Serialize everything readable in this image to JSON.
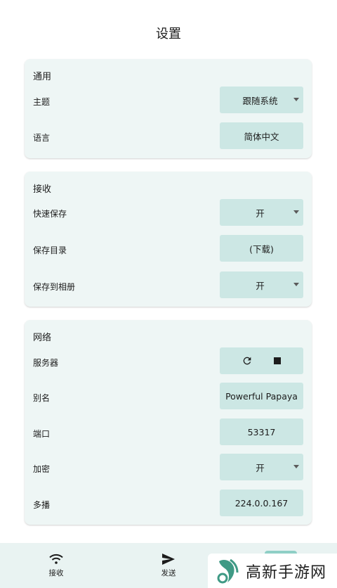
{
  "page_title": "设置",
  "sections": [
    {
      "title": "通用",
      "rows": [
        {
          "label": "主题",
          "value": "跟随系统",
          "type": "dropdown"
        },
        {
          "label": "语言",
          "value": "简体中文",
          "type": "button"
        }
      ]
    },
    {
      "title": "接收",
      "rows": [
        {
          "label": "快速保存",
          "value": "开",
          "type": "dropdown"
        },
        {
          "label": "保存目录",
          "value": "(下载)",
          "type": "button"
        },
        {
          "label": "保存到相册",
          "value": "开",
          "type": "dropdown"
        }
      ]
    },
    {
      "title": "网络",
      "rows": [
        {
          "label": "服务器",
          "type": "server-controls",
          "icons": [
            "refresh-icon",
            "stop-icon"
          ]
        },
        {
          "label": "别名",
          "value": "Powerful Papaya",
          "type": "field"
        },
        {
          "label": "端口",
          "value": "53317",
          "type": "field"
        },
        {
          "label": "加密",
          "value": "开",
          "type": "dropdown"
        },
        {
          "label": "多播",
          "value": "224.0.0.167",
          "type": "field"
        }
      ]
    }
  ],
  "bottom_nav": {
    "items": [
      {
        "label": "接收",
        "icon": "wifi-icon"
      },
      {
        "label": "发送",
        "icon": "send-icon"
      },
      {
        "label": "",
        "icon": "settings-icon",
        "active": true
      }
    ]
  },
  "watermark": {
    "text": "高新手游网"
  },
  "colors": {
    "card_bg": "#eef6f5",
    "control_bg": "#cce7e4",
    "nav_bg": "#e9f3f2",
    "active_indicator": "#8fcfc6",
    "watermark_green": "#3f9a85"
  }
}
